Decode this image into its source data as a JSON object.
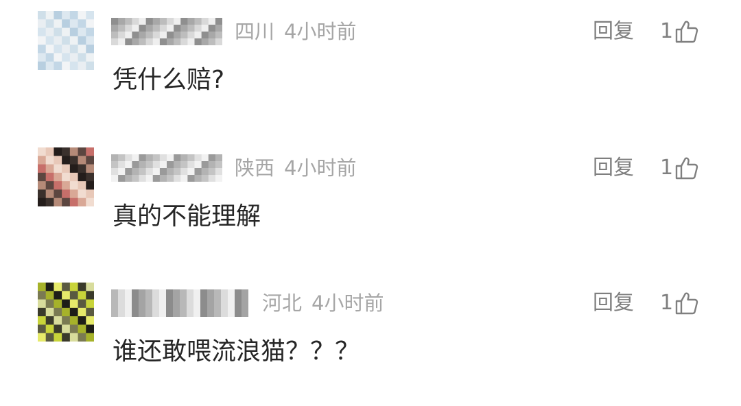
{
  "comments": [
    {
      "region": "四川",
      "time": "4小时前",
      "text": "凭什么赔?",
      "reply_label": "回复",
      "like_count": "1",
      "avatar_palette": [
        "#d6e4ee",
        "#e9eef2",
        "#c3d7e6",
        "#f2f4f6",
        "#b8cfe0",
        "#dde8f0",
        "#cfdfe9",
        "#eef2f4"
      ],
      "name_palette": [
        "#8f8f8f",
        "#d9d9d9",
        "#a8a8a8",
        "#efefef",
        "#bdbdbd"
      ]
    },
    {
      "region": "陕西",
      "time": "4小时前",
      "text": "真的不能理解",
      "reply_label": "回复",
      "like_count": "1",
      "avatar_palette": [
        "#3a302c",
        "#b58a78",
        "#e8c8b8",
        "#241d1b",
        "#d9a896",
        "#f1dcd0",
        "#5c4640",
        "#c76f6a"
      ],
      "name_palette": [
        "#9a9a9a",
        "#e0e0e0",
        "#b3b3b3",
        "#f2f2f2",
        "#c4c4c4"
      ]
    },
    {
      "region": "河北",
      "time": "4小时前",
      "text": "谁还敢喂流浪猫？？？",
      "reply_label": "回复",
      "like_count": "1",
      "avatar_palette": [
        "#c8d43a",
        "#3a3a2a",
        "#e6ea6a",
        "#5a5a40",
        "#a6b22a",
        "#1e1e18",
        "#d8dc9c",
        "#7a7a52"
      ],
      "name_palette": [
        "#8c8c8c",
        "#dcdcdc",
        "#a4a4a4",
        "#f0f0f0",
        "#b8b8b8"
      ]
    }
  ]
}
